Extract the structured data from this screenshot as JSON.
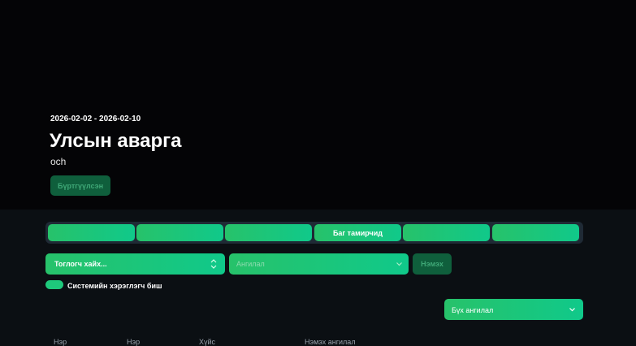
{
  "hero": {
    "date_range": "2026-02-02 - 2026-02-10",
    "title": "Улсын аварга",
    "subtitle": "och",
    "register_label": "Бүртгүүлсэн"
  },
  "tabs": [
    {
      "label": ""
    },
    {
      "label": ""
    },
    {
      "label": ""
    },
    {
      "label": "Баг тамирчид"
    },
    {
      "label": ""
    },
    {
      "label": ""
    }
  ],
  "filters": {
    "search_placeholder": "Тоглогч хайх...",
    "category_placeholder": "Ангилал",
    "add_label": "Нэмэх",
    "toggle_label": "Системийн хэрэглэгч биш",
    "all_category_label": "Бүх ангилал"
  },
  "table": {
    "headers": [
      "Нэр",
      "Нэр",
      "Хүйс",
      "Нэмэх ангилал"
    ]
  },
  "colors": {
    "accent_green": "#1ec97c",
    "dark_green": "#0f5f3c",
    "background": "#0b0f13",
    "hero_background": "#040406"
  }
}
